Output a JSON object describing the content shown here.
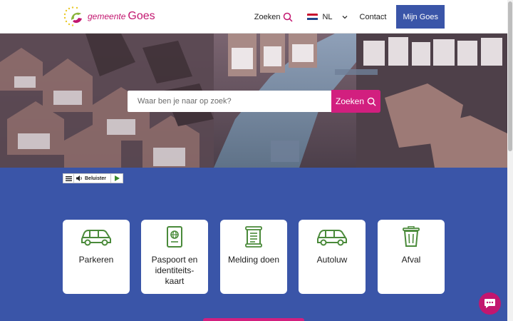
{
  "brand": {
    "small": "gemeente",
    "big": "Goes"
  },
  "nav": {
    "search_label": "Zoeken",
    "language": "NL",
    "contact": "Contact",
    "account": "Mijn Goes"
  },
  "hero": {
    "search_placeholder": "Waar ben je naar op zoek?",
    "search_button": "Zoeken"
  },
  "readspeaker": {
    "listen_label": "Beluister"
  },
  "tiles": [
    {
      "label": "Parkeren",
      "icon": "car-icon"
    },
    {
      "label": "Paspoort en identiteits-kaart",
      "icon": "passport-icon"
    },
    {
      "label": "Melding doen",
      "icon": "report-icon"
    },
    {
      "label": "Autoluw",
      "icon": "car-icon"
    },
    {
      "label": "Afval",
      "icon": "trash-icon"
    }
  ],
  "colors": {
    "brand_blue": "#3a55a8",
    "brand_pink": "#d21f7f",
    "logo_pink": "#c2166f",
    "icon_green": "#4a8a3a"
  }
}
